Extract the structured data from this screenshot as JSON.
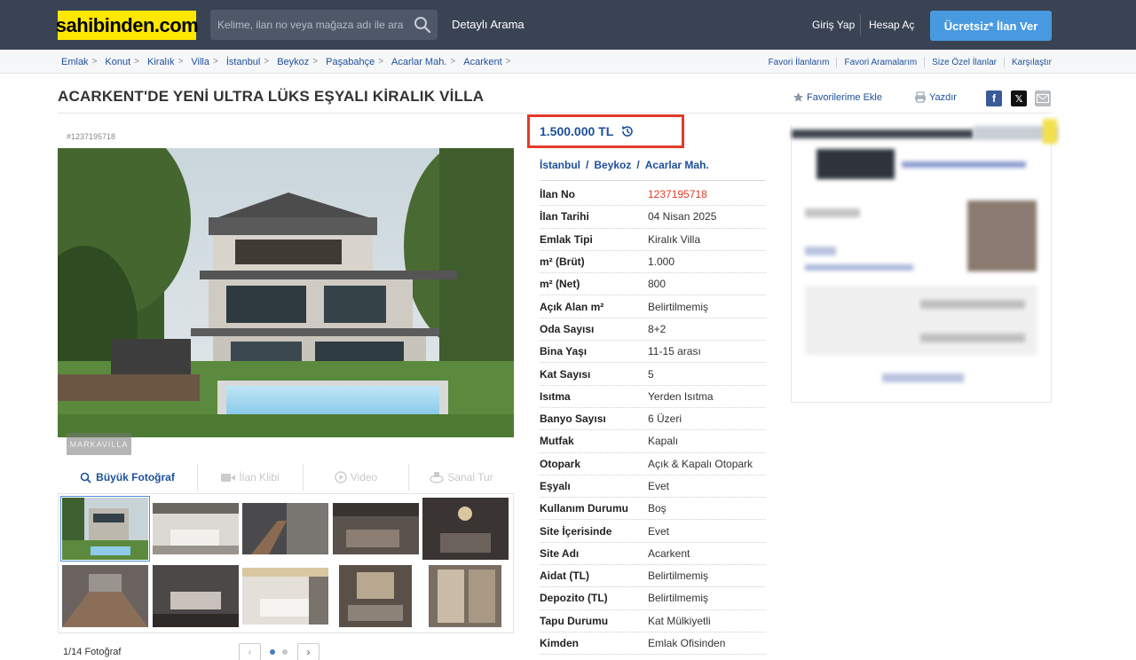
{
  "header": {
    "logo": "sahibinden.com",
    "search_placeholder": "Kelime, ilan no veya mağaza adı ile ara",
    "detailed_search": "Detaylı Arama",
    "login": "Giriş Yap",
    "signup": "Hesap Aç",
    "post_ad": "Ücretsiz* İlan Ver"
  },
  "breadcrumb": {
    "items": [
      "Emlak",
      "Konut",
      "Kiralık",
      "Villa",
      "İstanbul",
      "Beykoz",
      "Paşabahçe",
      "Acarlar Mah.",
      "Acarkent"
    ]
  },
  "quick_links": [
    "Favori İlanlarım",
    "Favori Aramalarım",
    "Size Özel İlanlar",
    "Karşılaştır"
  ],
  "listing": {
    "title": "ACARKENT'DE YENİ ULTRA LÜKS EŞYALI KİRALIK VİLLA",
    "add_favorite": "Favorilerime Ekle",
    "print": "Yazdır",
    "code": "#1237195718",
    "price": "1.500.000 TL",
    "location": [
      "İstanbul",
      "Beykoz",
      "Acarlar Mah."
    ],
    "details": [
      {
        "label": "İlan No",
        "value": "1237195718"
      },
      {
        "label": "İlan Tarihi",
        "value": "04 Nisan 2025"
      },
      {
        "label": "Emlak Tipi",
        "value": "Kiralık Villa"
      },
      {
        "label": "m² (Brüt)",
        "value": "1.000"
      },
      {
        "label": "m² (Net)",
        "value": "800"
      },
      {
        "label": "Açık Alan m²",
        "value": "Belirtilmemiş"
      },
      {
        "label": "Oda Sayısı",
        "value": "8+2"
      },
      {
        "label": "Bina Yaşı",
        "value": "11-15 arası"
      },
      {
        "label": "Kat Sayısı",
        "value": "5"
      },
      {
        "label": "Isıtma",
        "value": "Yerden Isıtma"
      },
      {
        "label": "Banyo Sayısı",
        "value": "6 Üzeri"
      },
      {
        "label": "Mutfak",
        "value": "Kapalı"
      },
      {
        "label": "Otopark",
        "value": "Açık & Kapalı Otopark"
      },
      {
        "label": "Eşyalı",
        "value": "Evet"
      },
      {
        "label": "Kullanım Durumu",
        "value": "Boş"
      },
      {
        "label": "Site İçerisinde",
        "value": "Evet"
      },
      {
        "label": "Site Adı",
        "value": "Acarkent"
      },
      {
        "label": "Aidat (TL)",
        "value": "Belirtilmemiş"
      },
      {
        "label": "Depozito (TL)",
        "value": "Belirtilmemiş"
      },
      {
        "label": "Tapu Durumu",
        "value": "Kat Mülkiyetli"
      },
      {
        "label": "Kimden",
        "value": "Emlak Ofisinden"
      }
    ]
  },
  "gallery": {
    "watermark": "MARKAVILLA",
    "tabs": {
      "photo": "Büyük Fotoğraf",
      "clip": "İlan Klibi",
      "video": "Video",
      "tour": "Sanal Tur"
    },
    "photo_count": "1/14 Fotoğraf"
  },
  "colors": {
    "header_bg": "#3a4354",
    "logo_bg": "#ffe800",
    "accent_blue": "#1c4f9c",
    "button_blue": "#489ae0",
    "highlight_red": "#e33b2a"
  }
}
